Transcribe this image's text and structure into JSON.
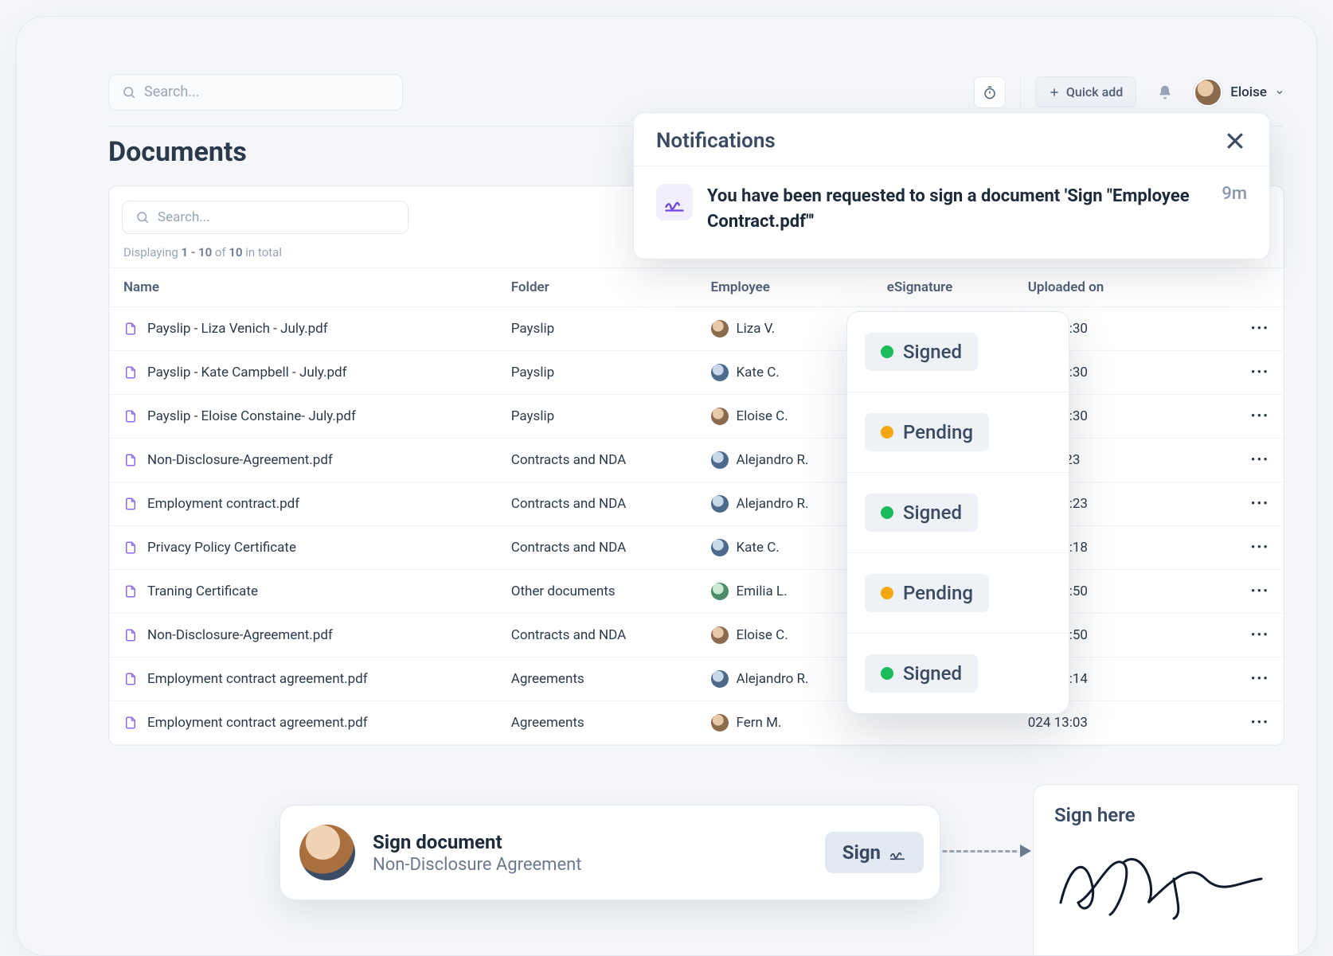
{
  "topbar": {
    "search_placeholder": "Search...",
    "quick_add_label": "Quick add",
    "user_name": "Eloise"
  },
  "page": {
    "title": "Documents",
    "table_search_placeholder": "Search...",
    "count_prefix": "Displaying ",
    "count_range": "1 - 10",
    "count_mid": " of ",
    "count_total": "10",
    "count_suffix": " in total"
  },
  "columns": {
    "name": "Name",
    "folder": "Folder",
    "employee": "Employee",
    "esig": "eSignature",
    "uploaded": "Uploaded on"
  },
  "rows": [
    {
      "name": "Payslip - Liza Venich - July.pdf",
      "folder": "Payslip",
      "emp": "Liza V.",
      "avClass": "",
      "uploaded": "024 13:30"
    },
    {
      "name": "Payslip - Kate Campbell - July.pdf",
      "folder": "Payslip",
      "emp": "Kate C.",
      "avClass": "b",
      "uploaded": "024 13:30"
    },
    {
      "name": "Payslip - Eloise Constaine- July.pdf",
      "folder": "Payslip",
      "emp": "Eloise C.",
      "avClass": "",
      "uploaded": "024 13:30"
    },
    {
      "name": "Non-Disclosure-Agreement.pdf",
      "folder": "Contracts and NDA",
      "emp": "Alejandro R.",
      "avClass": "b",
      "uploaded": "024 9:23"
    },
    {
      "name": "Employment contract.pdf",
      "folder": "Contracts and NDA",
      "emp": "Alejandro R.",
      "avClass": "b",
      "uploaded": "024 12:23"
    },
    {
      "name": "Privacy Policy Certificate",
      "folder": "Contracts and NDA",
      "emp": "Kate C.",
      "avClass": "b",
      "uploaded": "024 11:18"
    },
    {
      "name": "Traning Certificate",
      "folder": "Other documents",
      "emp": "Emilia L.",
      "avClass": "g",
      "uploaded": "024 15:50"
    },
    {
      "name": "Non-Disclosure-Agreement.pdf",
      "folder": "Contracts and NDA",
      "emp": "Eloise C.",
      "avClass": "",
      "uploaded": "024 15:50"
    },
    {
      "name": "Employment contract agreement.pdf",
      "folder": "Agreements",
      "emp": "Alejandro R.",
      "avClass": "b",
      "uploaded": "024 13:14"
    },
    {
      "name": "Employment contract agreement.pdf",
      "folder": "Agreements",
      "emp": "Fern M.",
      "avClass": "",
      "uploaded": "024 13:03"
    }
  ],
  "notifications": {
    "title": "Notifications",
    "item_text": "You have been requested to sign a document 'Sign \"Employee Contract.pdf\"'",
    "item_time": "9m"
  },
  "sig_statuses": [
    {
      "label": "Signed",
      "color": "green"
    },
    {
      "label": "Pending",
      "color": "amber"
    },
    {
      "label": "Signed",
      "color": "green"
    },
    {
      "label": "Pending",
      "color": "amber"
    },
    {
      "label": "Signed",
      "color": "green"
    }
  ],
  "sign_card": {
    "title": "Sign document",
    "subtitle": "Non-Disclosure Agreement",
    "button": "Sign"
  },
  "sign_here": {
    "title": "Sign here"
  }
}
